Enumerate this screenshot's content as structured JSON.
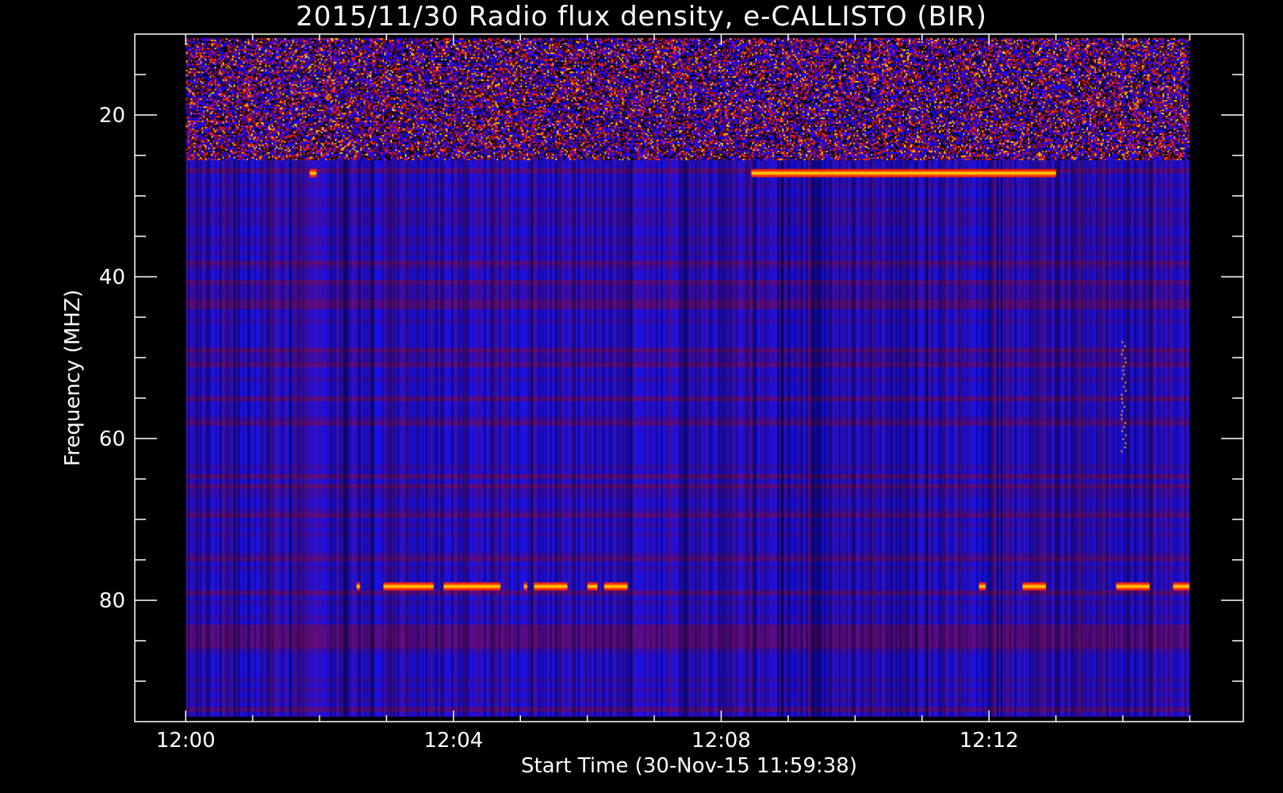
{
  "chart_data": {
    "type": "heatmap",
    "title": "2015/11/30  Radio flux density, e-CALLISTO (BIR)",
    "xlabel": "Start Time (30-Nov-15 11:59:38)",
    "ylabel": "Frequency (MHZ)",
    "x_tick_labels": [
      "12:00",
      "12:04",
      "12:08",
      "12:12"
    ],
    "y_tick_labels": [
      "20",
      "40",
      "60",
      "80"
    ],
    "x_ticks_minutes": [
      0,
      4,
      8,
      12
    ],
    "y_ticks_mhz": [
      20,
      40,
      60,
      80
    ],
    "x_range_minutes": [
      -0.76,
      15.8
    ],
    "y_range_mhz": [
      10,
      95
    ],
    "data_x_range_minutes": [
      0,
      15
    ],
    "data_y_range_mhz": [
      10.5,
      94.4
    ],
    "colormap": [
      "#000000",
      "#1a00ff",
      "#8a0a30",
      "#ff2a00",
      "#ffc000",
      "#ffffff"
    ],
    "background_color": "#1a10e8",
    "features": [
      {
        "name": "broadband interference band",
        "freq_mhz": [
          10.5,
          25.5
        ]
      },
      {
        "name": "carrier 78 MHz",
        "freq_mhz": 78.3,
        "time_segments_minutes": [
          [
            2.55,
            2.6
          ],
          [
            2.95,
            3.7
          ],
          [
            3.85,
            4.7
          ],
          [
            5.05,
            5.1
          ],
          [
            5.2,
            5.7
          ],
          [
            6.0,
            6.15
          ],
          [
            6.25,
            6.6
          ],
          [
            11.85,
            11.95
          ],
          [
            12.5,
            12.85
          ],
          [
            13.9,
            14.4
          ],
          [
            14.75,
            15.0
          ]
        ]
      },
      {
        "name": "carrier 27 MHz",
        "freq_mhz": 27.2,
        "time_segments_minutes": [
          [
            1.85,
            1.95
          ],
          [
            8.45,
            13.0
          ]
        ]
      },
      {
        "name": "burst",
        "time_minutes": 14.0,
        "freq_mhz": [
          48,
          62
        ]
      }
    ]
  }
}
